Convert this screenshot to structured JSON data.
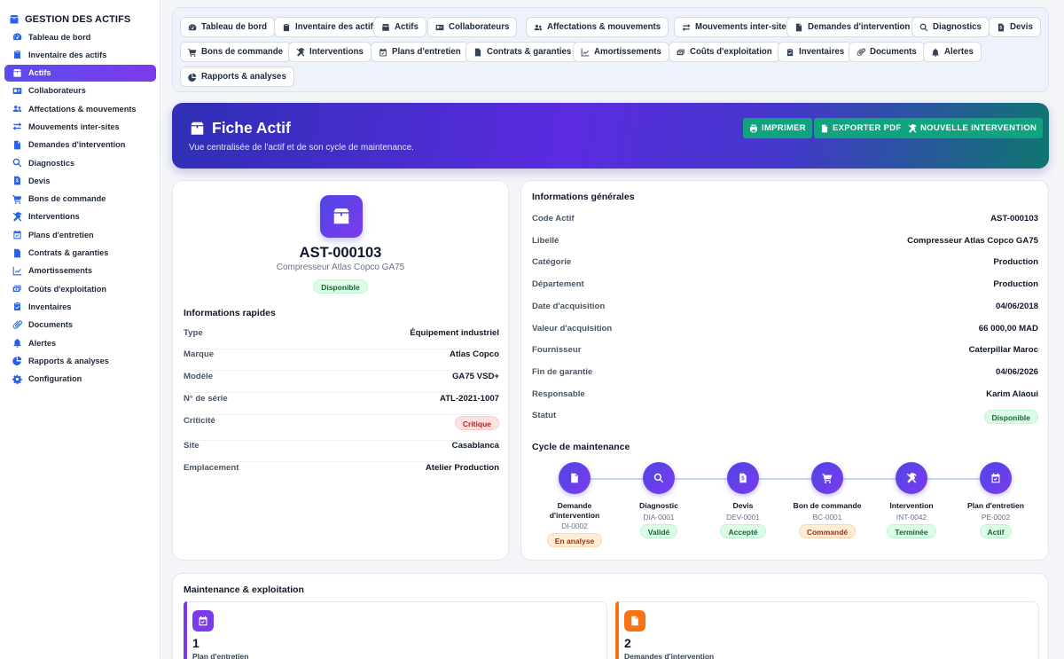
{
  "sidebar": {
    "title": "GESTION DES ACTIFS",
    "items": [
      {
        "label": "Tableau de bord",
        "icon": "dashboard-icon"
      },
      {
        "label": "Inventaire des actifs",
        "icon": "clipboard-icon"
      },
      {
        "label": "Actifs",
        "icon": "box-icon",
        "active": true
      },
      {
        "label": "Collaborateurs",
        "icon": "id-card-icon"
      },
      {
        "label": "Affectations & mouvements",
        "icon": "users-icon"
      },
      {
        "label": "Mouvements inter-sites",
        "icon": "swap-icon"
      },
      {
        "label": "Demandes d'intervention",
        "icon": "file-icon"
      },
      {
        "label": "Diagnostics",
        "icon": "search-icon"
      },
      {
        "label": "Devis",
        "icon": "invoice-icon"
      },
      {
        "label": "Bons de commande",
        "icon": "cart-icon"
      },
      {
        "label": "Interventions",
        "icon": "tools-icon"
      },
      {
        "label": "Plans d'entretien",
        "icon": "calendar-icon"
      },
      {
        "label": "Contrats & garanties",
        "icon": "contract-icon"
      },
      {
        "label": "Amortissements",
        "icon": "chart-line-icon"
      },
      {
        "label": "Coûts d'exploitation",
        "icon": "money-icon"
      },
      {
        "label": "Inventaires",
        "icon": "clipboard-check-icon"
      },
      {
        "label": "Documents",
        "icon": "paperclip-icon"
      },
      {
        "label": "Alertes",
        "icon": "bell-icon"
      },
      {
        "label": "Rapports & analyses",
        "icon": "pie-chart-icon"
      },
      {
        "label": "Configuration",
        "icon": "gear-icon"
      }
    ]
  },
  "topnav": {
    "items": [
      {
        "label": "Tableau de bord",
        "icon": "dashboard-icon"
      },
      {
        "label": "Inventaire des actifs",
        "icon": "clipboard-icon"
      },
      {
        "label": "Actifs",
        "icon": "box-icon"
      },
      {
        "label": "Collaborateurs",
        "icon": "id-card-icon"
      },
      {
        "label": "Affectations & mouvements",
        "icon": "users-icon"
      },
      {
        "label": "Mouvements inter-sites",
        "icon": "swap-icon"
      },
      {
        "label": "Demandes d'intervention",
        "icon": "file-icon"
      },
      {
        "label": "Diagnostics",
        "icon": "search-icon"
      },
      {
        "label": "Devis",
        "icon": "invoice-icon"
      },
      {
        "label": "Bons de commande",
        "icon": "cart-icon"
      },
      {
        "label": "Interventions",
        "icon": "tools-icon"
      },
      {
        "label": "Plans d'entretien",
        "icon": "calendar-icon"
      },
      {
        "label": "Contrats & garanties",
        "icon": "contract-icon"
      },
      {
        "label": "Amortissements",
        "icon": "chart-line-icon"
      },
      {
        "label": "Coûts d'exploitation",
        "icon": "money-icon"
      },
      {
        "label": "Inventaires",
        "icon": "clipboard-check-icon"
      },
      {
        "label": "Documents",
        "icon": "paperclip-icon"
      },
      {
        "label": "Alertes",
        "icon": "bell-icon"
      },
      {
        "label": "Rapports & analyses",
        "icon": "pie-chart-icon"
      }
    ]
  },
  "hero": {
    "title": "Fiche Actif",
    "subtitle": "Vue centralisée de l'actif et de son cycle de maintenance.",
    "buttons": {
      "print": "IMPRIMER",
      "export": "EXPORTER PDF",
      "new": "NOUVELLE INTERVENTION"
    }
  },
  "asset": {
    "code": "AST-000103",
    "name": "Compresseur Atlas Copco GA75",
    "status": "Disponible"
  },
  "quick": {
    "title": "Informations rapides",
    "rows": [
      {
        "k": "Type",
        "v": "Équipement industriel"
      },
      {
        "k": "Marque",
        "v": "Atlas Copco"
      },
      {
        "k": "Modèle",
        "v": "GA75 VSD+"
      },
      {
        "k": "N° de série",
        "v": "ATL-2021-1007"
      },
      {
        "k": "Criticité",
        "v": "Critique"
      },
      {
        "k": "Site",
        "v": "Casablanca"
      },
      {
        "k": "Emplacement",
        "v": "Atelier Production"
      }
    ]
  },
  "general": {
    "title": "Informations générales",
    "rows": [
      {
        "k": "Code Actif",
        "v": "AST-000103"
      },
      {
        "k": "Libellé",
        "v": "Compresseur Atlas Copco GA75"
      },
      {
        "k": "Catégorie",
        "v": "Production"
      },
      {
        "k": "Département",
        "v": "Production"
      },
      {
        "k": "Date d'acquisition",
        "v": "04/06/2018"
      },
      {
        "k": "Valeur d'acquisition",
        "v": "66 000,00 MAD"
      },
      {
        "k": "Fournisseur",
        "v": "Caterpillar Maroc"
      },
      {
        "k": "Fin de garantie",
        "v": "04/06/2026"
      },
      {
        "k": "Responsable",
        "v": "Karim Alaoui"
      },
      {
        "k": "Statut",
        "v": "Disponible"
      }
    ]
  },
  "cycle": {
    "title": "Cycle de maintenance",
    "steps": [
      {
        "label": "Demande d'intervention",
        "ref": "DI-0002",
        "status": "En analyse",
        "tone": "orange",
        "icon": "file-icon"
      },
      {
        "label": "Diagnostic",
        "ref": "DIA-0001",
        "status": "Validé",
        "tone": "green",
        "icon": "search-icon"
      },
      {
        "label": "Devis",
        "ref": "DEV-0001",
        "status": "Accepté",
        "tone": "green",
        "icon": "invoice-icon"
      },
      {
        "label": "Bon de commande",
        "ref": "BC-0001",
        "status": "Commandé",
        "tone": "orange",
        "icon": "cart-icon"
      },
      {
        "label": "Intervention",
        "ref": "INT-0042",
        "status": "Terminée",
        "tone": "green",
        "icon": "tools-icon"
      },
      {
        "label": "Plan d'entretien",
        "ref": "PE-0002",
        "status": "Actif",
        "tone": "green",
        "icon": "calendar-icon"
      }
    ]
  },
  "maintenance": {
    "title": "Maintenance & exploitation",
    "stats": [
      {
        "value": "1",
        "label": "Plan d'entretien",
        "color": "#7c3aed",
        "icon": "calendar-icon"
      },
      {
        "value": "2",
        "label": "Demandes d'intervention",
        "color": "#f97316",
        "icon": "file-icon"
      }
    ]
  },
  "colors": {
    "accent": "#5b4cf0",
    "success": "#10a37f",
    "warning": "#f97316"
  }
}
